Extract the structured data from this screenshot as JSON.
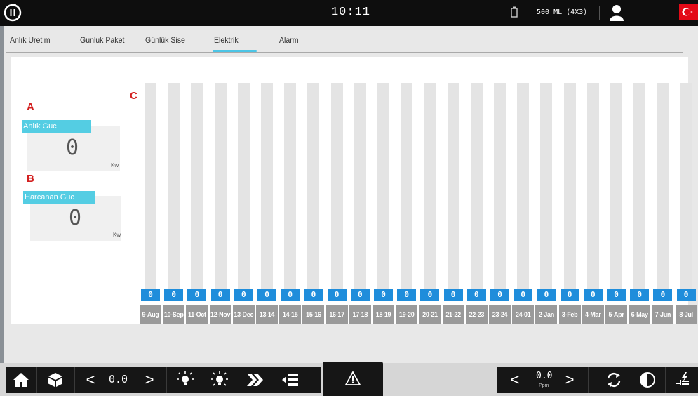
{
  "header": {
    "time": "10:11",
    "volume": "500 ML (4X3)",
    "icons": {
      "power": "power-icon",
      "bottle": "bottle-icon",
      "user": "user-icon",
      "flag": "turkish-flag-icon"
    }
  },
  "tabs": [
    {
      "label": "Anlık Uretim",
      "active": false
    },
    {
      "label": "Gunluk Paket",
      "active": false
    },
    {
      "label": "Günlük Sise",
      "active": false
    },
    {
      "label": "Elektrik",
      "active": true
    },
    {
      "label": "Alarm",
      "active": false
    }
  ],
  "annotations": {
    "a": "A",
    "b": "B",
    "c": "C"
  },
  "gauges": {
    "instant": {
      "title": "Anlık Guc",
      "value": "0",
      "unit": "Kw"
    },
    "consumed": {
      "title": "Harcanan Guc",
      "value": "0",
      "unit": "Kw"
    }
  },
  "chart_data": {
    "type": "bar",
    "categories": [
      "9-Aug",
      "10-Sep",
      "11-Oct",
      "12-Nov",
      "13-Dec",
      "13-14",
      "14-15",
      "15-16",
      "16-17",
      "17-18",
      "18-19",
      "19-20",
      "20-21",
      "21-22",
      "22-23",
      "23-24",
      "24-01",
      "2-Jan",
      "3-Feb",
      "4-Mar",
      "5-Apr",
      "6-May",
      "7-Jun",
      "8-Jul"
    ],
    "values": [
      0,
      0,
      0,
      0,
      0,
      0,
      0,
      0,
      0,
      0,
      0,
      0,
      0,
      0,
      0,
      0,
      0,
      0,
      0,
      0,
      0,
      0,
      0,
      0
    ],
    "value_labels": [
      "0",
      "0",
      "0",
      "0",
      "0",
      "0",
      "0",
      "0",
      "0",
      "0",
      "0",
      "0",
      "0",
      "0",
      "0",
      "0",
      "0",
      "0",
      "0",
      "0",
      "0",
      "0",
      "0",
      "0"
    ]
  },
  "footer": {
    "left_speed": {
      "value": "0.0",
      "prev": "<",
      "next": ">"
    },
    "right_speed": {
      "value": "0.0",
      "unit": "Ppm",
      "prev": "<",
      "next": ">"
    },
    "colors": {
      "accent": "#4cc5e6",
      "bar": "#1f8ddb",
      "annotation": "#d32020"
    }
  }
}
